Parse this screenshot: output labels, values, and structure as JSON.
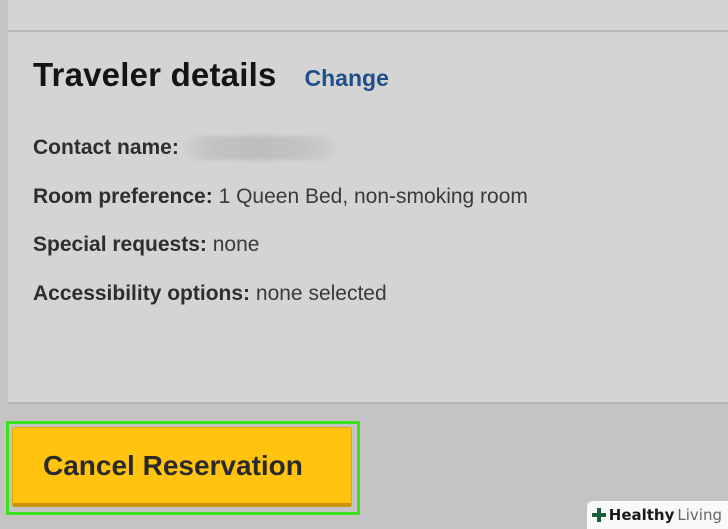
{
  "traveler_details": {
    "heading": "Traveler details",
    "change_link": "Change",
    "contact_name_label": "Contact name:",
    "room_preference_label": "Room preference:",
    "room_preference_value": "1 Queen Bed, non-smoking room",
    "special_requests_label": "Special requests:",
    "special_requests_value": "none",
    "accessibility_label": "Accessibility options:",
    "accessibility_value": "none selected"
  },
  "actions": {
    "cancel_label": "Cancel Reservation"
  },
  "watermark": {
    "brand": "Healthy",
    "living": "Living"
  },
  "colors": {
    "link": "#1f4e8c",
    "button": "#ffc310",
    "highlight": "#39e21d",
    "watermark_plus": "#1b5e3a"
  }
}
